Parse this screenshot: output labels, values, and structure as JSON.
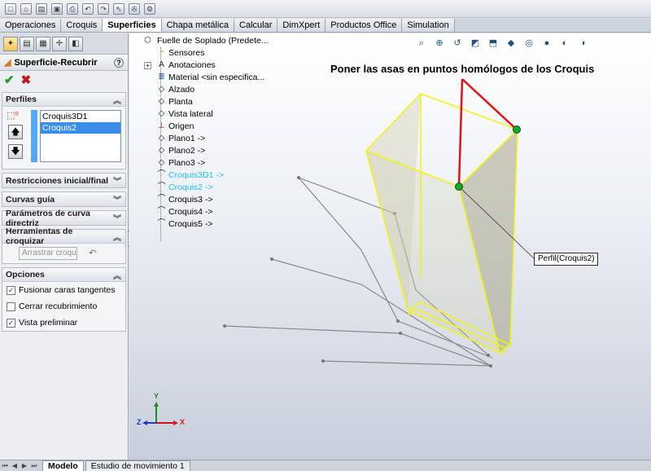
{
  "toolbar_icons": [
    "new-icon",
    "home-icon",
    "file-icon",
    "save-icon",
    "print-icon",
    "undo-icon",
    "redo-icon",
    "select-icon",
    "rebuild-icon",
    "options-icon"
  ],
  "tabs": [
    {
      "label": "Operaciones",
      "active": false
    },
    {
      "label": "Croquis",
      "active": false
    },
    {
      "label": "Superficies",
      "active": true
    },
    {
      "label": "Chapa metálica",
      "active": false
    },
    {
      "label": "Calcular",
      "active": false
    },
    {
      "label": "DimXpert",
      "active": false
    },
    {
      "label": "Productos Office",
      "active": false
    },
    {
      "label": "Simulation",
      "active": false
    }
  ],
  "property_manager": {
    "title": "Superficie-Recubrir",
    "help": "?",
    "ok_glyph": "✔",
    "cancel_glyph": "✖",
    "perfiles": {
      "heading": "Perfiles",
      "items": [
        "Croquis3D1",
        "Croquis2"
      ],
      "selected_index": 1,
      "up_glyph": "🡅",
      "down_glyph": "🡇"
    },
    "restricciones": "Restricciones inicial/final",
    "curvas_guia": "Curvas guía",
    "parametros": "Parámetros de curva directriz",
    "herramientas": {
      "heading": "Herramientas de croquizar",
      "arrastrar": "Arrastrar croquis"
    },
    "opciones": {
      "heading": "Opciones",
      "items": [
        {
          "label": "Fusionar caras tangentes",
          "checked": true
        },
        {
          "label": "Cerrar recubrimiento",
          "checked": false
        },
        {
          "label": "Vista preliminar",
          "checked": true
        }
      ]
    }
  },
  "feature_tree": {
    "root": "Fuelle de Soplado  (Predete...",
    "nodes": [
      {
        "label": "Sensores",
        "icon": "sensor-icon",
        "expand": false,
        "highlight": false
      },
      {
        "label": "Anotaciones",
        "icon": "annotation-icon",
        "expand": true,
        "highlight": false
      },
      {
        "label": "Material <sin especifica...",
        "icon": "material-icon",
        "expand": false,
        "highlight": false
      },
      {
        "label": "Alzado",
        "icon": "plane-icon",
        "expand": false,
        "highlight": false
      },
      {
        "label": "Planta",
        "icon": "plane-icon",
        "expand": false,
        "highlight": false
      },
      {
        "label": "Vista lateral",
        "icon": "plane-icon",
        "expand": false,
        "highlight": false
      },
      {
        "label": "Origen",
        "icon": "origin-icon",
        "expand": false,
        "highlight": false
      },
      {
        "label": "Plano1 ->",
        "icon": "plane-icon",
        "expand": false,
        "highlight": false
      },
      {
        "label": "Plano2 ->",
        "icon": "plane-icon",
        "expand": false,
        "highlight": false
      },
      {
        "label": "Plano3 ->",
        "icon": "plane-icon",
        "expand": false,
        "highlight": false
      },
      {
        "label": "Croquis3D1 ->",
        "icon": "sketch3d-icon",
        "expand": false,
        "highlight": true
      },
      {
        "label": "Croquis2 ->",
        "icon": "sketch-icon",
        "expand": false,
        "highlight": true
      },
      {
        "label": "Croquis3 ->",
        "icon": "sketch-icon",
        "expand": false,
        "highlight": false
      },
      {
        "label": "Croquis4 ->",
        "icon": "sketch-icon",
        "expand": false,
        "highlight": false
      },
      {
        "label": "Croquis5 ->",
        "icon": "sketch-icon",
        "expand": false,
        "highlight": false
      }
    ]
  },
  "headsup_icons": [
    "zoom-fit-icon",
    "zoom-area-icon",
    "previous-view-icon",
    "section-view-icon",
    "view-orientation-icon",
    "display-style-icon",
    "hide-show-icon",
    "edit-appearance-icon",
    "scene-icon",
    "display-pane-icon"
  ],
  "annotation": "Poner las asas en puntos homólogos de los Croquis",
  "callout": "Perfil(Croquis2)",
  "triad": {
    "x": "X",
    "y": "Y",
    "z": "Z"
  },
  "colors": {
    "loft_edge": "#f2f21a",
    "handle_line": "#e0121a",
    "handle": "#16a82a",
    "sketch_line": "#888888"
  },
  "bottom_tabs": [
    {
      "label": "Modelo",
      "active": true
    },
    {
      "label": "Estudio de movimiento 1",
      "active": false
    }
  ]
}
